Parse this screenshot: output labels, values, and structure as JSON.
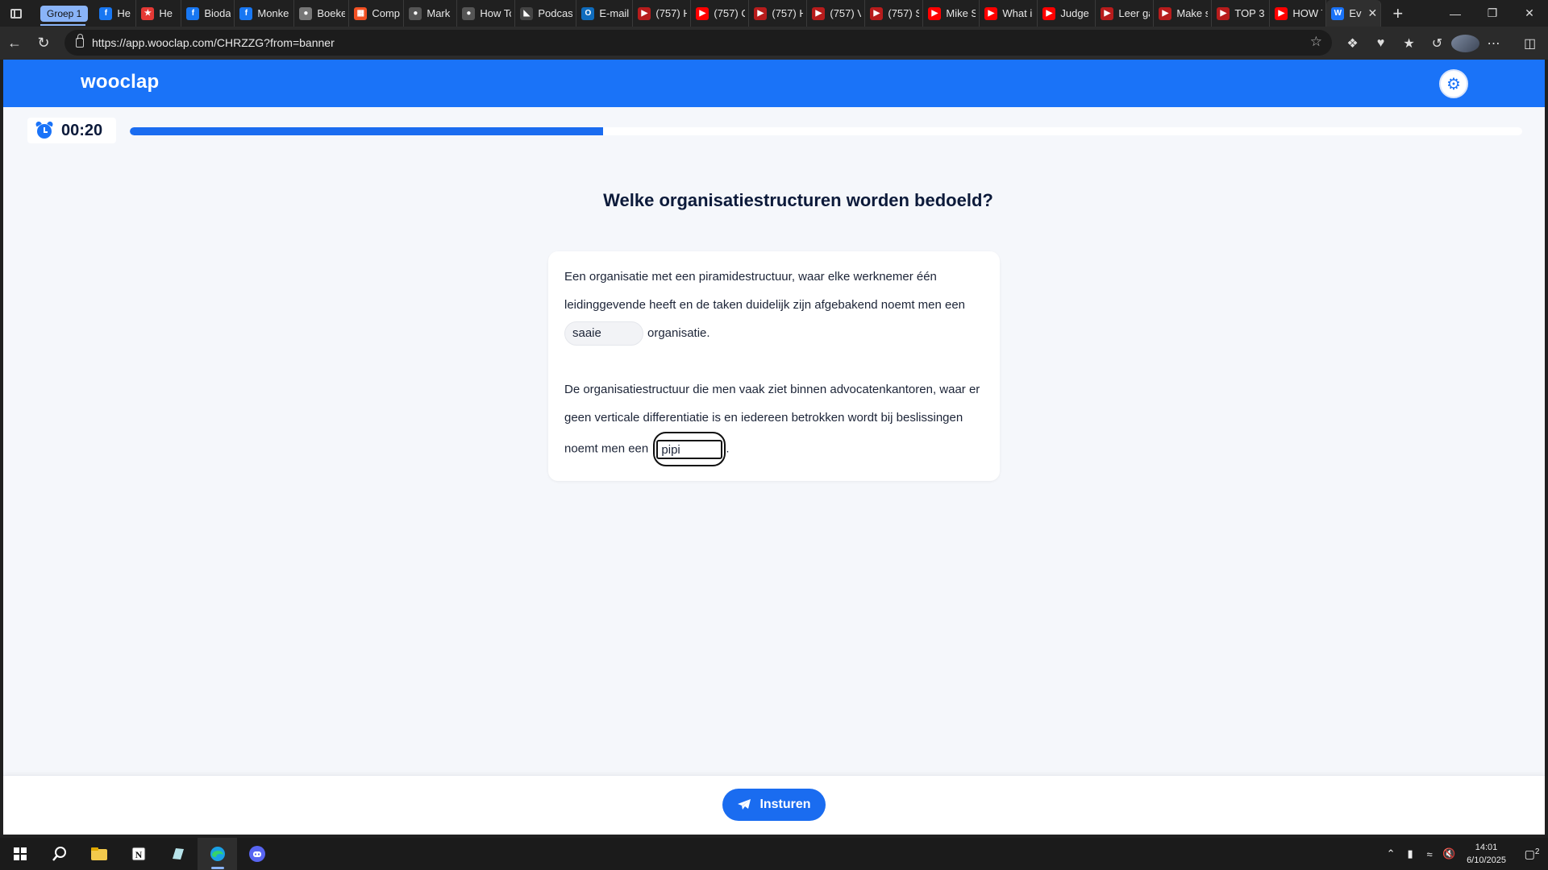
{
  "browser": {
    "tab_group_label": "Groep 1",
    "tabs": [
      {
        "title": "He",
        "icon": "facebook-icon",
        "color": "#1877f2"
      },
      {
        "title": "He",
        "icon": "star-icon",
        "color": "#e53935"
      },
      {
        "title": "Biodan",
        "icon": "facebook-icon",
        "color": "#1877f2"
      },
      {
        "title": "Monke",
        "icon": "facebook-icon",
        "color": "#1877f2"
      },
      {
        "title": "Boeker",
        "icon": "globe-icon",
        "color": "#777777"
      },
      {
        "title": "Compi",
        "icon": "microsoft-icon",
        "color": "#f25022"
      },
      {
        "title": "Mark P",
        "icon": "globe-icon",
        "color": "#555555"
      },
      {
        "title": "How To",
        "icon": "globe-icon",
        "color": "#555555"
      },
      {
        "title": "Podcas",
        "icon": "podcast-icon",
        "color": "#444444"
      },
      {
        "title": "E-mail",
        "icon": "outlook-icon",
        "color": "#0f6cbd"
      },
      {
        "title": "(757) H",
        "icon": "youtube-icon",
        "color": "#b71c1c"
      },
      {
        "title": "(757) C",
        "icon": "youtube-icon",
        "color": "#ff0000"
      },
      {
        "title": "(757) H",
        "icon": "youtube-icon",
        "color": "#b71c1c"
      },
      {
        "title": "(757) V",
        "icon": "youtube-icon",
        "color": "#b71c1c"
      },
      {
        "title": "(757) S",
        "icon": "youtube-icon",
        "color": "#b71c1c"
      },
      {
        "title": "Mike S",
        "icon": "youtube-icon",
        "color": "#ff0000"
      },
      {
        "title": "What i",
        "icon": "youtube-icon",
        "color": "#ff0000"
      },
      {
        "title": "Judge",
        "icon": "youtube-icon",
        "color": "#ff0000"
      },
      {
        "title": "Leer ga",
        "icon": "youtube-icon",
        "color": "#b71c1c"
      },
      {
        "title": "Make s",
        "icon": "youtube-icon",
        "color": "#b71c1c"
      },
      {
        "title": "TOP 3",
        "icon": "youtube-icon",
        "color": "#b71c1c"
      },
      {
        "title": "HOW T",
        "icon": "youtube-icon",
        "color": "#ff0000"
      },
      {
        "title": "Ev",
        "icon": "wooclap-icon",
        "color": "#1a73f8",
        "active": true
      }
    ],
    "url": "https://app.wooclap.com/CHRZZG?from=banner"
  },
  "app": {
    "brand": "wooclap",
    "accent_color": "#1a73f8",
    "timer": "00:20",
    "progress_fraction": 0.34,
    "question": "Welke organisatiestructuren worden bedoeld?",
    "paragraph1": {
      "before": "Een organisatie met een piramidestructuur, waar elke werknemer één leidinggevende heeft en de taken duidelijk zijn afgebakend noemt men een",
      "answer": "saaie",
      "after": "organisatie."
    },
    "paragraph2": {
      "before": "De organisatiestructuur die men vaak ziet binnen advocatenkantoren, waar er geen verticale differentiatie is en iedereen betrokken wordt bij beslissingen noemt men een",
      "answer": "pipi",
      "after": "."
    },
    "submit_label": "Insturen"
  },
  "taskbar": {
    "time": "14:01",
    "date": "6/10/2025",
    "notification_count": "2",
    "apps": [
      "start-icon",
      "search-icon",
      "file-explorer-icon",
      "notion-icon",
      "app-icon",
      "edge-icon",
      "discord-icon"
    ]
  }
}
